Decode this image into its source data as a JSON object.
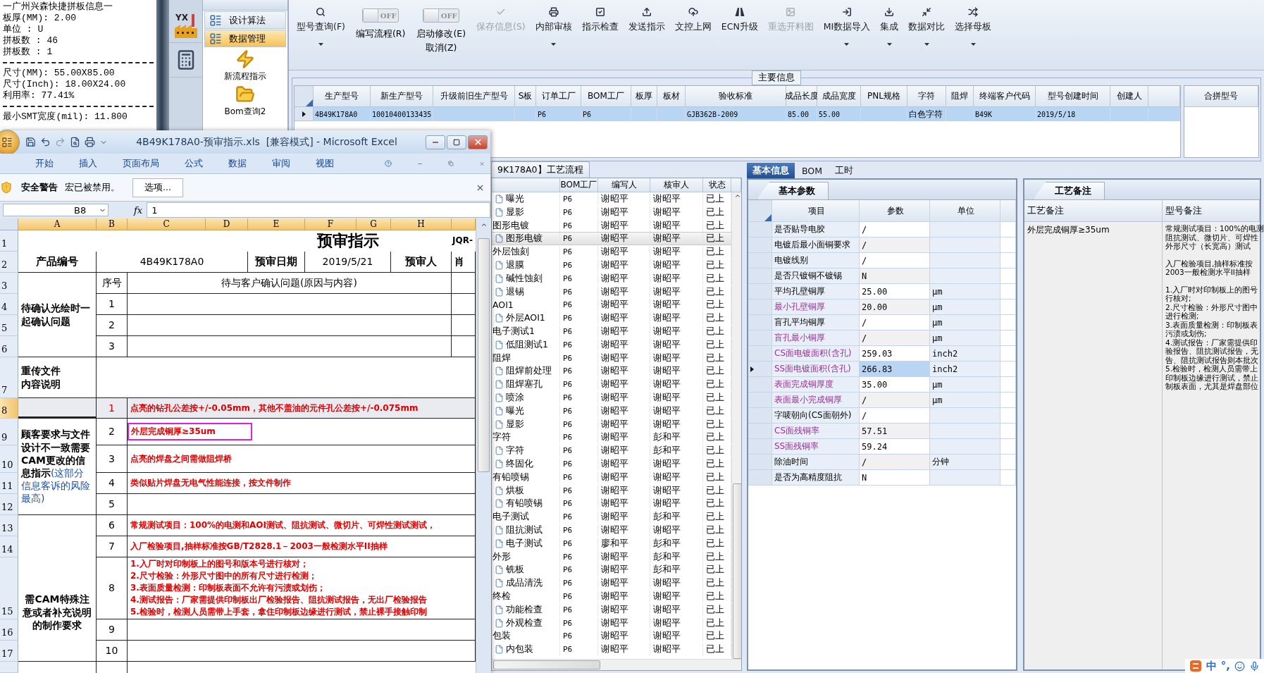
{
  "info_panel": {
    "lines": [
      {
        "kind": "text",
        "text": "一广州兴森快捷拼板信息一"
      },
      {
        "kind": "text",
        "text": "板厚(MM): 2.00"
      },
      {
        "kind": "text",
        "text": "单位 : U"
      },
      {
        "kind": "text",
        "text": "拼板数 : 46"
      },
      {
        "kind": "text",
        "text": "拼板数 : 1"
      },
      {
        "kind": "rule"
      },
      {
        "kind": "text",
        "text": "尺寸(MM): 55.00X85.00"
      },
      {
        "kind": "text",
        "text": "尺寸(Inch): 18.00X24.00"
      },
      {
        "kind": "text",
        "text": "利用率: 77.41%"
      },
      {
        "kind": "rule"
      },
      {
        "kind": "text",
        "text": "最小SMT宽度(mil): 11.800"
      }
    ]
  },
  "nav": {
    "logo_text": "YX"
  },
  "menu": {
    "items": [
      {
        "label": "设计算法",
        "selected": false
      },
      {
        "label": "数据管理",
        "selected": true
      }
    ],
    "actions": [
      {
        "label": "新流程指示"
      },
      {
        "label": "Bom查询2"
      }
    ]
  },
  "toolbar": [
    {
      "kind": "button",
      "label": "型号查询(F)",
      "dropdown": true,
      "disabled": false
    },
    {
      "kind": "toggle",
      "label": "编写流程(R)",
      "switch": "OFF",
      "on": false
    },
    {
      "kind": "toggle",
      "label": "启动修改(E)",
      "sublabel": "取消(Z)",
      "switch": "OFF",
      "on": false
    },
    {
      "kind": "button",
      "label": "保存信息(S)",
      "dropdown": false,
      "disabled": true
    },
    {
      "kind": "button",
      "label": "内部审核",
      "dropdown": true,
      "disabled": false
    },
    {
      "kind": "button",
      "label": "指示检查",
      "dropdown": false,
      "disabled": false
    },
    {
      "kind": "button",
      "label": "发送指示",
      "dropdown": false,
      "disabled": false
    },
    {
      "kind": "button",
      "label": "文控上网",
      "dropdown": false,
      "disabled": false
    },
    {
      "kind": "button",
      "label": "ECN升级",
      "dropdown": false,
      "disabled": false
    },
    {
      "kind": "button",
      "label": "重选开料图",
      "dropdown": false,
      "disabled": true
    },
    {
      "kind": "button",
      "label": "MI数据导入",
      "dropdown": true,
      "disabled": false
    },
    {
      "kind": "button",
      "label": "集成",
      "dropdown": true,
      "disabled": false
    },
    {
      "kind": "button",
      "label": "数据对比",
      "dropdown": true,
      "disabled": false
    },
    {
      "kind": "button",
      "label": "选择母板",
      "dropdown": true,
      "disabled": false
    }
  ],
  "main_info": {
    "title": "主要信息",
    "columns": [
      "生产型号",
      "新生产型号",
      "升级前旧生产型号",
      "S板",
      "订单工厂",
      "BOM工厂",
      "板厚",
      "板材",
      "验收标准",
      "成品长度",
      "成品宽度",
      "PNL规格",
      "字符",
      "阻焊",
      "终端客户代码",
      "型号创建时间",
      "创建人"
    ],
    "rows": [
      {
        "selected": true,
        "cells": [
          "4B49K178A0",
          "10010400133435",
          null,
          null,
          "P6",
          "P6",
          null,
          null,
          "GJB362B-2009",
          "85.00",
          "55.00",
          null,
          "白色字符",
          null,
          "B49K",
          "2019/5/18",
          null
        ]
      }
    ],
    "side_column": "合拼型号"
  },
  "excel": {
    "title": "4B49K178A0-预审指示.xls  [兼容模式] - Microsoft Excel",
    "tabs": [
      "开始",
      "插入",
      "页面布局",
      "公式",
      "数据",
      "审阅",
      "视图"
    ],
    "security": {
      "title": "安全警告",
      "message": "宏已被禁用。",
      "button": "选项..."
    },
    "formula": {
      "name_box": "B8",
      "fx": "fx",
      "value": "1"
    },
    "sheet": {
      "columns": [
        "A",
        "B",
        "C",
        "D",
        "E",
        "F",
        "G",
        "H"
      ],
      "row_headers": [
        {
          "label": "1",
          "selected": false
        },
        {
          "label": "2",
          "selected": false
        },
        {
          "label": "3",
          "selected": false
        },
        {
          "label": "4",
          "selected": false
        },
        {
          "label": "5",
          "selected": false
        },
        {
          "label": "6",
          "selected": false
        },
        {
          "label": "7",
          "selected": false
        },
        {
          "label": "8",
          "selected": true
        },
        {
          "label": "9",
          "selected": false
        },
        {
          "label": "10",
          "selected": false
        },
        {
          "label": "11",
          "selected": false
        },
        {
          "label": "12",
          "selected": false
        },
        {
          "label": "13",
          "selected": false
        },
        {
          "label": "14",
          "selected": false
        },
        {
          "label": "15",
          "selected": false
        },
        {
          "label": "16",
          "selected": false
        },
        {
          "label": "17",
          "selected": false
        }
      ],
      "title": "预审指示",
      "doc_code": "JQR-",
      "header": {
        "product_label": "产品编号",
        "product_no": "4B49K178A0",
        "date_label": "预审日期",
        "date": "2019/5/21",
        "reviewer_label": "预审人",
        "reviewer": "肖"
      },
      "confirm": {
        "label": "待确认光绘时一起确认问题",
        "seq_label": "序号",
        "question_label": "待与客户确认问题(原因与内容)",
        "items": [
          "1",
          "2",
          "3"
        ]
      },
      "reupload": {
        "lines": [
          "重传文件",
          "内容说明"
        ]
      },
      "cam_change": {
        "label": "顾客要求与文件设计不一致需要CAM更改的信息指示",
        "note": "(这部分信息客诉的风险最高)",
        "items": [
          {
            "no": "1",
            "text": "点亮的钻孔公差按+/-0.05mm，其他不盖油的元件孔公差按+/-0.075mm",
            "selected": true
          },
          {
            "no": "2",
            "text": "外层完成铜厚≥35um",
            "selected": false,
            "boxed": true
          },
          {
            "no": "3",
            "text": "点亮的焊盘之间需做阻焊桥",
            "selected": false
          },
          {
            "no": "4",
            "text": "类似贴片焊盘无电气性能连接，按文件制作",
            "selected": false
          },
          {
            "no": "5",
            "selected": false
          }
        ]
      },
      "cam_notes": {
        "label": "需CAM特殊注意或者补充说明的制作要求",
        "items": [
          {
            "no": "6",
            "lines": [
              "常规测试项目：100%的电测和AOI测试、阻抗测试、微切片、可焊性测试测试，"
            ]
          },
          {
            "no": "7",
            "lines": [
              "入厂检验项目,抽样标准按GB/T2828.1－2003一般检测水平II抽样"
            ]
          },
          {
            "no": "8",
            "lines": [
              "1.入厂时对印制板上的图号和版本号进行核对；",
              "2.尺寸检验：外形尺寸图中的所有尺寸进行检测；",
              "3.表面质量检测：印制板表面不允许有污渍或划伤；",
              "4.测试报告：厂家需提供印制板出厂检验报告、阻抗测试报告，无出厂检验报告",
              "5.检验时，检测人员需带上手套，拿住印制板边缘进行测试，禁止裸手接触印制"
            ]
          },
          {
            "no": "9"
          },
          {
            "no": "10"
          }
        ]
      }
    }
  },
  "process": {
    "tab": "9K178A0】工艺流程",
    "columns": [
      "BOM工厂",
      "编写人",
      "核审人",
      "状态"
    ],
    "steps": [
      {
        "children": [
          {
            "name": "曝光",
            "bom": "P6",
            "writer": "谢昭平",
            "reviewer": "谢昭平",
            "status": "已上",
            "selected": false
          },
          {
            "name": "显影",
            "bom": "P6",
            "writer": "谢昭平",
            "reviewer": "谢昭平",
            "status": "已上",
            "selected": false
          }
        ]
      },
      {
        "name": "图形电镀",
        "bom": "P6",
        "writer": "谢昭平",
        "reviewer": "谢昭平",
        "status": "已上",
        "selected": false,
        "children": [
          {
            "name": "图形电镀",
            "bom": "P6",
            "writer": "谢昭平",
            "reviewer": "谢昭平",
            "status": "已上",
            "selected": true
          }
        ]
      },
      {
        "name": "外层蚀刻",
        "bom": "P6",
        "writer": "谢昭平",
        "reviewer": "谢昭平",
        "status": "已上",
        "selected": false,
        "children": [
          {
            "name": "退膜",
            "bom": "P6",
            "writer": "谢昭平",
            "reviewer": "谢昭平",
            "status": "已上",
            "selected": false
          },
          {
            "name": "碱性蚀刻",
            "bom": "P6",
            "writer": "谢昭平",
            "reviewer": "谢昭平",
            "status": "已上",
            "selected": false
          },
          {
            "name": "退锡",
            "bom": "P6",
            "writer": "谢昭平",
            "reviewer": "谢昭平",
            "status": "已上",
            "selected": false
          }
        ]
      },
      {
        "name": "AOI1",
        "bom": "P6",
        "writer": "谢昭平",
        "reviewer": "谢昭平",
        "status": "已上",
        "selected": false,
        "children": [
          {
            "name": "外层AOI1",
            "bom": "P6",
            "writer": "谢昭平",
            "reviewer": "谢昭平",
            "status": "已上",
            "selected": false
          }
        ]
      },
      {
        "name": "电子测试1",
        "bom": "P6",
        "writer": "谢昭平",
        "reviewer": "谢昭平",
        "status": "已上",
        "selected": false,
        "children": [
          {
            "name": "低阻测试1",
            "bom": "P6",
            "writer": "谢昭平",
            "reviewer": "谢昭平",
            "status": "已上",
            "selected": false
          }
        ]
      },
      {
        "name": "阻焊",
        "bom": "P6",
        "writer": "谢昭平",
        "reviewer": "谢昭平",
        "status": "已上",
        "selected": false,
        "children": [
          {
            "name": "阻焊前处理",
            "bom": "P6",
            "writer": "谢昭平",
            "reviewer": "谢昭平",
            "status": "已上",
            "selected": false
          },
          {
            "name": "阻焊塞孔",
            "bom": "P6",
            "writer": "谢昭平",
            "reviewer": "谢昭平",
            "status": "已上",
            "selected": false
          },
          {
            "name": "喷涂",
            "bom": "P6",
            "writer": "谢昭平",
            "reviewer": "谢昭平",
            "status": "已上",
            "selected": false
          },
          {
            "name": "曝光",
            "bom": "P6",
            "writer": "谢昭平",
            "reviewer": "谢昭平",
            "status": "已上",
            "selected": false
          },
          {
            "name": "显影",
            "bom": "P6",
            "writer": "谢昭平",
            "reviewer": "谢昭平",
            "status": "已上",
            "selected": false
          }
        ]
      },
      {
        "name": "字符",
        "bom": "P6",
        "writer": "谢昭平",
        "reviewer": "彭和平",
        "status": "已上",
        "selected": false,
        "children": [
          {
            "name": "字符",
            "bom": "P6",
            "writer": "谢昭平",
            "reviewer": "彭和平",
            "status": "已上",
            "selected": false
          },
          {
            "name": "终固化",
            "bom": "P6",
            "writer": "谢昭平",
            "reviewer": "谢昭平",
            "status": "已上",
            "selected": false
          }
        ]
      },
      {
        "name": "有铅喷锡",
        "bom": "P6",
        "writer": "谢昭平",
        "reviewer": "谢昭平",
        "status": "已上",
        "selected": false,
        "children": [
          {
            "name": "烘板",
            "bom": "P6",
            "writer": "谢昭平",
            "reviewer": "谢昭平",
            "status": "已上",
            "selected": false
          },
          {
            "name": "有铅喷锡",
            "bom": "P6",
            "writer": "谢昭平",
            "reviewer": "谢昭平",
            "status": "已上",
            "selected": false
          }
        ]
      },
      {
        "name": "电子测试",
        "bom": "P6",
        "writer": "谢昭平",
        "reviewer": "彭和平",
        "status": "已上",
        "selected": false,
        "children": [
          {
            "name": "阻抗测试",
            "bom": "P6",
            "writer": "谢昭平",
            "reviewer": "谢昭平",
            "status": "已上",
            "selected": false
          },
          {
            "name": "电子测试",
            "bom": "P6",
            "writer": "廖和平",
            "reviewer": "彭和平",
            "status": "已上",
            "selected": false
          }
        ]
      },
      {
        "name": "外形",
        "bom": "P6",
        "writer": "谢昭平",
        "reviewer": "彭和平",
        "status": "已上",
        "selected": false,
        "children": [
          {
            "name": "铣板",
            "bom": "P6",
            "writer": "谢昭平",
            "reviewer": "彭和平",
            "status": "已上",
            "selected": false
          },
          {
            "name": "成品清洗",
            "bom": "P6",
            "writer": "谢昭平",
            "reviewer": "谢昭平",
            "status": "已上",
            "selected": false
          }
        ]
      },
      {
        "name": "终检",
        "bom": "P6",
        "writer": "谢昭平",
        "reviewer": "谢昭平",
        "status": "已上",
        "selected": false,
        "children": [
          {
            "name": "功能检查",
            "bom": "P6",
            "writer": "谢昭平",
            "reviewer": "谢昭平",
            "status": "已上",
            "selected": false
          },
          {
            "name": "外观检查",
            "bom": "P6",
            "writer": "谢昭平",
            "reviewer": "谢昭平",
            "status": "已上",
            "selected": false
          }
        ]
      },
      {
        "name": "包装",
        "bom": "P6",
        "writer": "谢昭平",
        "reviewer": "谢昭平",
        "status": "已上",
        "selected": false,
        "children": [
          {
            "name": "内包装",
            "bom": "P6",
            "writer": "谢昭平",
            "reviewer": "谢昭平",
            "status": "已上",
            "selected": false
          }
        ]
      }
    ]
  },
  "detail": {
    "tabs": [
      {
        "label": "基本信息",
        "selected": true
      },
      {
        "label": "BOM",
        "selected": false
      },
      {
        "label": "工时",
        "selected": false
      }
    ],
    "params": {
      "tab": "基本参数",
      "columns": [
        "项目",
        "参数",
        "单位"
      ],
      "rows": [
        {
          "name": "是否贴导电胶",
          "value": "/",
          "emphasized": false,
          "selected": false
        },
        {
          "name": "电镀后最小面铜要求",
          "value": "/",
          "emphasized": false,
          "selected": false
        },
        {
          "name": "电镀线别",
          "value": "/",
          "emphasized": false,
          "selected": false
        },
        {
          "name": "是否只镀铜不镀锡",
          "value": "N",
          "emphasized": false,
          "selected": false
        },
        {
          "name": "平均孔壁铜厚",
          "value": "25.00",
          "unit": "μm",
          "emphasized": false,
          "selected": false
        },
        {
          "name": "最小孔壁铜厚",
          "value": "20.00",
          "unit": "μm",
          "emphasized": true,
          "selected": false
        },
        {
          "name": "盲孔平均铜厚",
          "value": "/",
          "unit": "μm",
          "emphasized": false,
          "selected": false
        },
        {
          "name": "盲孔最小铜厚",
          "value": "/",
          "unit": "μm",
          "emphasized": true,
          "selected": false
        },
        {
          "name": "CS面电镀面积(含孔)",
          "value": "259.03",
          "unit": "inch2",
          "emphasized": true,
          "selected": false
        },
        {
          "name": "SS面电镀面积(含孔)",
          "value": "266.83",
          "unit": "inch2",
          "emphasized": true,
          "selected": true
        },
        {
          "name": "表面完成铜厚度",
          "value": "35.00",
          "unit": "μm",
          "emphasized": true,
          "selected": false
        },
        {
          "name": "表面最小完成铜厚",
          "value": "/",
          "unit": "μm",
          "emphasized": true,
          "selected": false
        },
        {
          "name": "字唛朝向(CS面朝外)",
          "value": "/",
          "emphasized": false,
          "selected": false
        },
        {
          "name": "CS面残铜率",
          "value": "57.51",
          "emphasized": true,
          "selected": false
        },
        {
          "name": "SS面残铜率",
          "value": "59.24",
          "emphasized": true,
          "selected": false
        },
        {
          "name": "除油时间",
          "value": "/",
          "unit": "分钟",
          "emphasized": false,
          "selected": false
        },
        {
          "name": "是否为高精度阻抗",
          "value": "N",
          "emphasized": false,
          "selected": false
        }
      ]
    },
    "notes": {
      "tab": "工艺备注",
      "columns": [
        "工艺备注",
        "型号备注"
      ],
      "process_note": "外层完成铜厚≥35um",
      "model_note": [
        [
          "常规测试项目：100%的电测",
          "阻抗测试、微切片、可焊性",
          "外形尺寸（长宽高）测试"
        ],
        [
          "入厂检验项目,抽样标准按",
          "2003一般检测水平II抽样"
        ],
        [
          "1.入厂时对印制板上的图号",
          "行核对;",
          "2.尺寸检验：外形尺寸图中",
          "进行检测;",
          "3.表面质量检测：印制板表",
          "污渍或划伤;",
          "4.测试报告：厂家需提供印",
          "验报告、阻抗测试报告，无",
          "告、阻抗测试报告则本批次",
          "5.检验时，检测人员需带上",
          "印制板边缘进行测试，禁止",
          "制板表面，尤其是焊盘部位"
        ]
      ]
    }
  },
  "ime": {
    "mode": "中",
    "punctuation": "°,"
  }
}
